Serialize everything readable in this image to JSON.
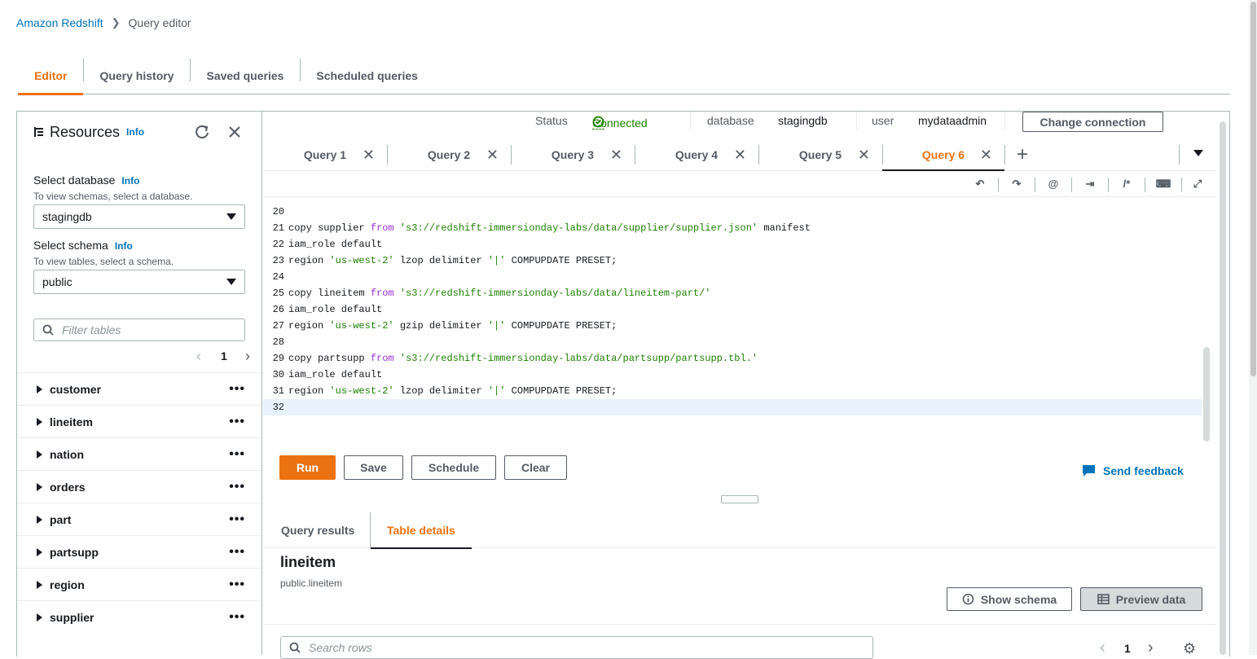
{
  "breadcrumb": {
    "root": "Amazon Redshift",
    "current": "Query editor"
  },
  "top_tabs": [
    "Editor",
    "Query history",
    "Saved queries",
    "Scheduled queries"
  ],
  "sidebar": {
    "title": "Resources",
    "info": "Info",
    "db_label": "Select database",
    "db_desc": "To view schemas, select a database.",
    "db_value": "stagingdb",
    "schema_label": "Select schema",
    "schema_desc": "To view tables, select a schema.",
    "schema_value": "public",
    "filter_placeholder": "Filter tables",
    "page": "1",
    "tables": [
      "customer",
      "lineitem",
      "nation",
      "orders",
      "part",
      "partsupp",
      "region",
      "supplier"
    ]
  },
  "status": {
    "status_label": "Status",
    "status_value": "Connected",
    "db_label": "database",
    "db_value": "stagingdb",
    "user_label": "user",
    "user_value": "mydataadmin",
    "change_button": "Change connection"
  },
  "query_tabs": [
    "Query 1",
    "Query 2",
    "Query 3",
    "Query 4",
    "Query 5",
    "Query 6"
  ],
  "code_lines": [
    {
      "n": "20",
      "segs": []
    },
    {
      "n": "21",
      "segs": [
        [
          "t",
          "copy supplier "
        ],
        [
          "k",
          "from"
        ],
        [
          "t",
          " "
        ],
        [
          "s",
          "'s3://redshift-immersionday-labs/data/supplier/supplier.json'"
        ],
        [
          "t",
          " manifest"
        ]
      ]
    },
    {
      "n": "22",
      "segs": [
        [
          "t",
          "iam_role default"
        ]
      ]
    },
    {
      "n": "23",
      "segs": [
        [
          "t",
          "region "
        ],
        [
          "s",
          "'us-west-2'"
        ],
        [
          "t",
          " lzop delimiter "
        ],
        [
          "s",
          "'|'"
        ],
        [
          "t",
          " COMPUPDATE PRESET;"
        ]
      ]
    },
    {
      "n": "24",
      "segs": []
    },
    {
      "n": "25",
      "segs": [
        [
          "t",
          "copy lineitem "
        ],
        [
          "k",
          "from"
        ],
        [
          "t",
          " "
        ],
        [
          "s",
          "'s3://redshift-immersionday-labs/data/lineitem-part/'"
        ]
      ]
    },
    {
      "n": "26",
      "segs": [
        [
          "t",
          "iam_role default"
        ]
      ]
    },
    {
      "n": "27",
      "segs": [
        [
          "t",
          "region "
        ],
        [
          "s",
          "'us-west-2'"
        ],
        [
          "t",
          " gzip delimiter "
        ],
        [
          "s",
          "'|'"
        ],
        [
          "t",
          " COMPUPDATE PRESET;"
        ]
      ]
    },
    {
      "n": "28",
      "segs": []
    },
    {
      "n": "29",
      "segs": [
        [
          "t",
          "copy partsupp "
        ],
        [
          "k",
          "from"
        ],
        [
          "t",
          " "
        ],
        [
          "s",
          "'s3://redshift-immersionday-labs/data/partsupp/partsupp.tbl.'"
        ]
      ]
    },
    {
      "n": "30",
      "segs": [
        [
          "t",
          "iam_role default"
        ]
      ]
    },
    {
      "n": "31",
      "segs": [
        [
          "t",
          "region "
        ],
        [
          "s",
          "'us-west-2'"
        ],
        [
          "t",
          " lzop delimiter "
        ],
        [
          "s",
          "'|'"
        ],
        [
          "t",
          " COMPUPDATE PRESET;"
        ]
      ]
    },
    {
      "n": "32",
      "segs": []
    }
  ],
  "actions": {
    "run": "Run",
    "save": "Save",
    "schedule": "Schedule",
    "clear": "Clear",
    "feedback": "Send feedback"
  },
  "results": {
    "tab_results": "Query results",
    "tab_details": "Table details",
    "table_name": "lineitem",
    "table_path": "public.lineitem",
    "show_schema": "Show schema",
    "preview_data": "Preview data",
    "search_placeholder": "Search rows",
    "page": "1"
  },
  "colors": {
    "accent": "#ec7211",
    "link": "#0073bb",
    "success": "#1d8102",
    "keyword": "#9b30d6"
  }
}
